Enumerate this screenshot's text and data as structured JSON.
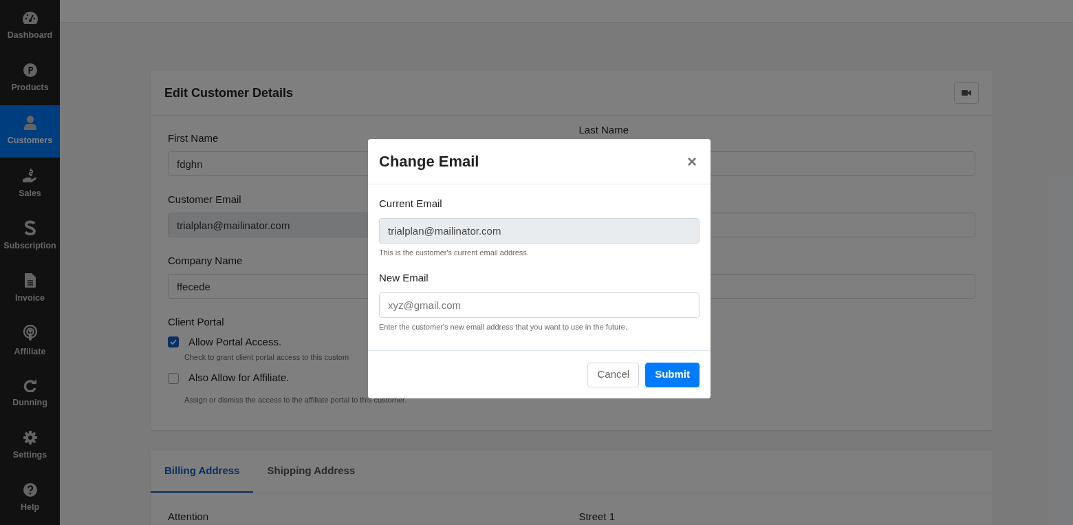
{
  "sidebar": {
    "items": [
      {
        "label": "Dashboard",
        "selected": false
      },
      {
        "label": "Products",
        "selected": false
      },
      {
        "label": "Customers",
        "selected": true
      },
      {
        "label": "Sales",
        "selected": false
      },
      {
        "label": "Subscription",
        "selected": false
      },
      {
        "label": "Invoice",
        "selected": false
      },
      {
        "label": "Affiliate",
        "selected": false
      },
      {
        "label": "Dunning",
        "selected": false
      },
      {
        "label": "Settings",
        "selected": false
      },
      {
        "label": "Help",
        "selected": false
      }
    ]
  },
  "card": {
    "title": "Edit Customer Details",
    "first_name": {
      "label": "First Name",
      "value": "fdghn"
    },
    "last_name": {
      "label": "Last Name"
    },
    "customer_email": {
      "label": "Customer Email",
      "value": "trialplan@mailinator.com"
    },
    "company_name": {
      "label": "Company Name",
      "value": "ffecede"
    },
    "client_portal": {
      "label": "Client Portal",
      "options": [
        {
          "label": "Allow Portal Access.",
          "help": "Check to grant client portal access to this custom",
          "checked": true
        },
        {
          "label": "Also Allow for Affiliate.",
          "help": "Assign or dismiss the access to the affiliate portal to this customer.",
          "checked": false
        }
      ]
    }
  },
  "address_card": {
    "tabs": [
      {
        "label": "Billing Address",
        "selected": true
      },
      {
        "label": "Shipping Address",
        "selected": false
      }
    ],
    "fields": [
      "Attention",
      "Street 1"
    ]
  },
  "modal": {
    "title": "Change Email",
    "close": "×",
    "current_email": {
      "label": "Current Email",
      "value": "trialplan@mailinator.com",
      "help": "This is the customer's current email address."
    },
    "new_email": {
      "label": "New Email",
      "placeholder": "xyz@gmail.com",
      "help": "Enter the customer's new email address that you want to use in the future."
    },
    "buttons": [
      {
        "label": "Cancel",
        "kind": "secondary"
      },
      {
        "label": "Submit",
        "kind": "primary"
      }
    ]
  }
}
